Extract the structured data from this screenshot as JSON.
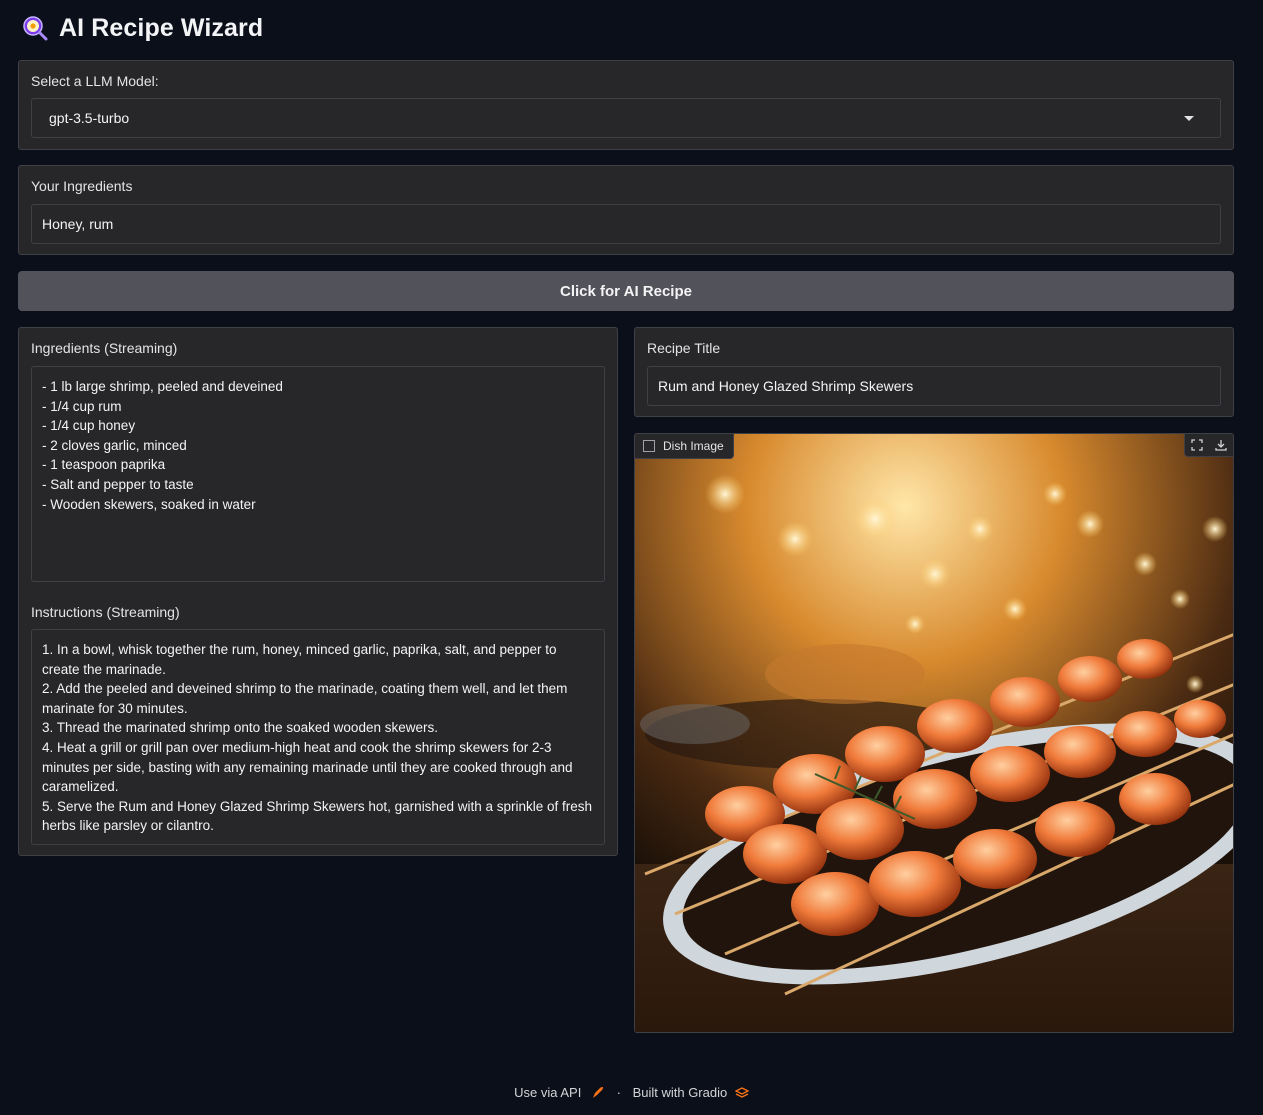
{
  "app": {
    "title": "AI Recipe Wizard",
    "icon": "magnifier-egg-icon"
  },
  "model": {
    "label": "Select a LLM Model:",
    "value": "gpt-3.5-turbo"
  },
  "ingredients_input": {
    "label": "Your Ingredients",
    "value": "Honey, rum"
  },
  "action": {
    "button_label": "Click for AI Recipe"
  },
  "ingredients_output": {
    "label": "Ingredients (Streaming)",
    "lines": [
      "- 1 lb large shrimp, peeled and deveined",
      "- 1/4 cup rum",
      "- 1/4 cup honey",
      "- 2 cloves garlic, minced",
      "- 1 teaspoon paprika",
      "- Salt and pepper to taste",
      "- Wooden skewers, soaked in water"
    ]
  },
  "instructions_output": {
    "label": "Instructions (Streaming)",
    "lines": [
      "1. In a bowl, whisk together the rum, honey, minced garlic, paprika, salt, and pepper to create the marinade.",
      "2. Add the peeled and deveined shrimp to the marinade, coating them well, and let them marinate for 30 minutes.",
      "3. Thread the marinated shrimp onto the soaked wooden skewers.",
      "4. Heat a grill or grill pan over medium-high heat and cook the shrimp skewers for 2-3 minutes per side, basting with any remaining marinade until they are cooked through and caramelized.",
      "5. Serve the Rum and Honey Glazed Shrimp Skewers hot, garnished with a sprinkle of fresh herbs like parsley or cilantro."
    ]
  },
  "recipe_title": {
    "label": "Recipe Title",
    "value": "Rum and Honey Glazed Shrimp Skewers"
  },
  "dish_image": {
    "label": "Dish Image",
    "tools": [
      "fullscreen-icon",
      "download-icon"
    ]
  },
  "footer": {
    "api_label": "Use via API",
    "separator": "·",
    "built_label": "Built with Gradio"
  },
  "colors": {
    "background": "#0b0f19",
    "panel": "#27272a",
    "border": "#3f3f46",
    "button": "#52525b",
    "accent": "#f97316"
  }
}
